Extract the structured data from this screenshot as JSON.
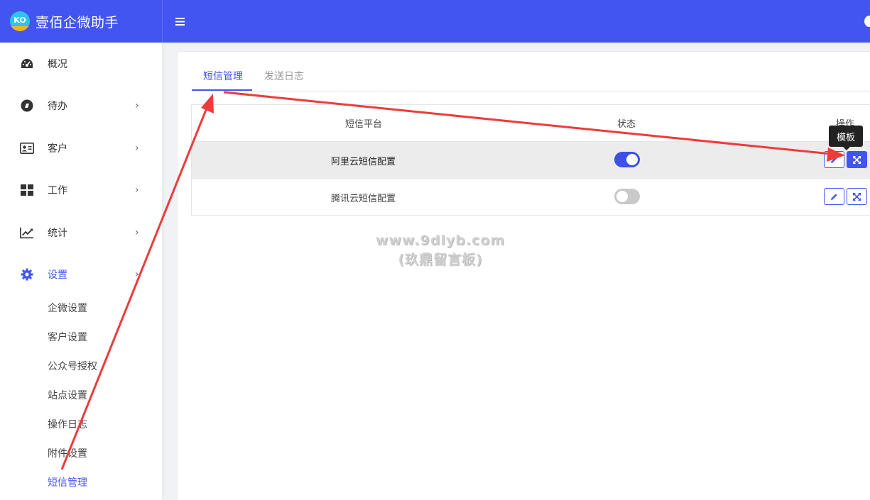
{
  "header": {
    "logo_text": "KO",
    "title": "壹佰企微助手",
    "menu_toggle_icon": "hamburger-icon",
    "brand_color": "#4355f0"
  },
  "sidebar": {
    "items": [
      {
        "label": "概况",
        "icon": "dashboard-icon",
        "arrow": ""
      },
      {
        "label": "待办",
        "icon": "todo-icon",
        "arrow": "›"
      },
      {
        "label": "客户",
        "icon": "id-card-icon",
        "arrow": "›"
      },
      {
        "label": "工作",
        "icon": "grid-icon",
        "arrow": "›"
      },
      {
        "label": "统计",
        "icon": "chart-line-icon",
        "arrow": "›"
      },
      {
        "label": "设置",
        "icon": "gear-icon",
        "arrow": "›"
      }
    ],
    "subitems": [
      "企微设置",
      "客户设置",
      "公众号授权",
      "站点设置",
      "操作日志",
      "附件设置",
      "短信管理"
    ],
    "active_subitem": "短信管理"
  },
  "tabs": [
    {
      "label": "短信管理",
      "active": true
    },
    {
      "label": "发送日志",
      "active": false
    }
  ],
  "table": {
    "columns": [
      "短信平台",
      "状态",
      "操作"
    ],
    "rows": [
      {
        "name": "阿里云短信配置",
        "status_on": true
      },
      {
        "name": "腾讯云短信配置",
        "status_on": false
      }
    ]
  },
  "tooltip": "模板",
  "watermark": {
    "line1": "www.9dlyb.com",
    "line2": "(玖鼎留言板)"
  },
  "annotation_color": "#ee3b3b"
}
